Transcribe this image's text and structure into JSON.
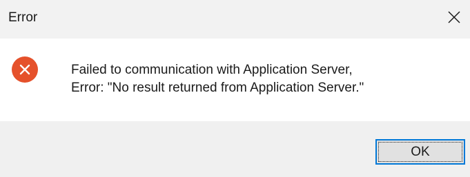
{
  "window": {
    "title": "Error",
    "close_icon": "close-icon"
  },
  "content": {
    "icon": "error-icon",
    "icon_color": "#e5512b",
    "message_line1": "Failed to communication with Application Server,",
    "message_line2": "Error: \"No result returned from Application Server.\""
  },
  "buttons": {
    "ok_label": "OK"
  },
  "colors": {
    "titlebar_bg": "#f2f2f2",
    "footer_bg": "#f0f0f0",
    "button_focus_border": "#0078d7"
  }
}
